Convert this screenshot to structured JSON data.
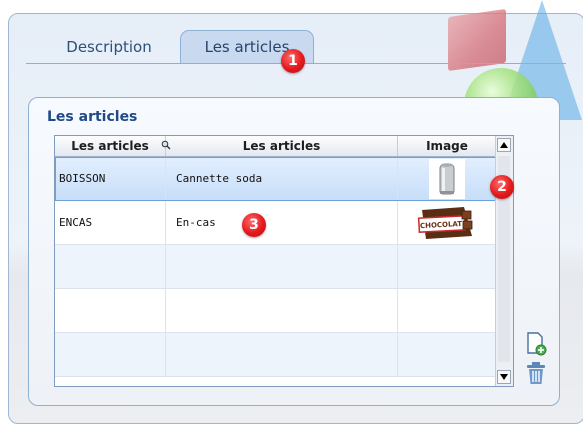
{
  "tabs": [
    {
      "label": "Description"
    },
    {
      "label": "Les articles"
    }
  ],
  "badges": [
    "1",
    "2",
    "3"
  ],
  "group": {
    "title": "Les articles"
  },
  "table": {
    "columns": [
      "Les articles",
      "Les articles",
      "Image"
    ],
    "rows": [
      {
        "code": "BOISSON",
        "label": "Cannette soda",
        "image": "soda-can-image"
      },
      {
        "code": "ENCAS",
        "label": "En-cas",
        "image": "chocolate-bar-image"
      }
    ],
    "choco_text": "CHOCOLAT"
  },
  "icons": {
    "sort": "search-icon",
    "add": "add-document-icon",
    "delete": "trash-icon"
  },
  "colors": {
    "accent": "#1f4a86",
    "badge": "#e3191d",
    "selected_row": "#c7def8"
  }
}
